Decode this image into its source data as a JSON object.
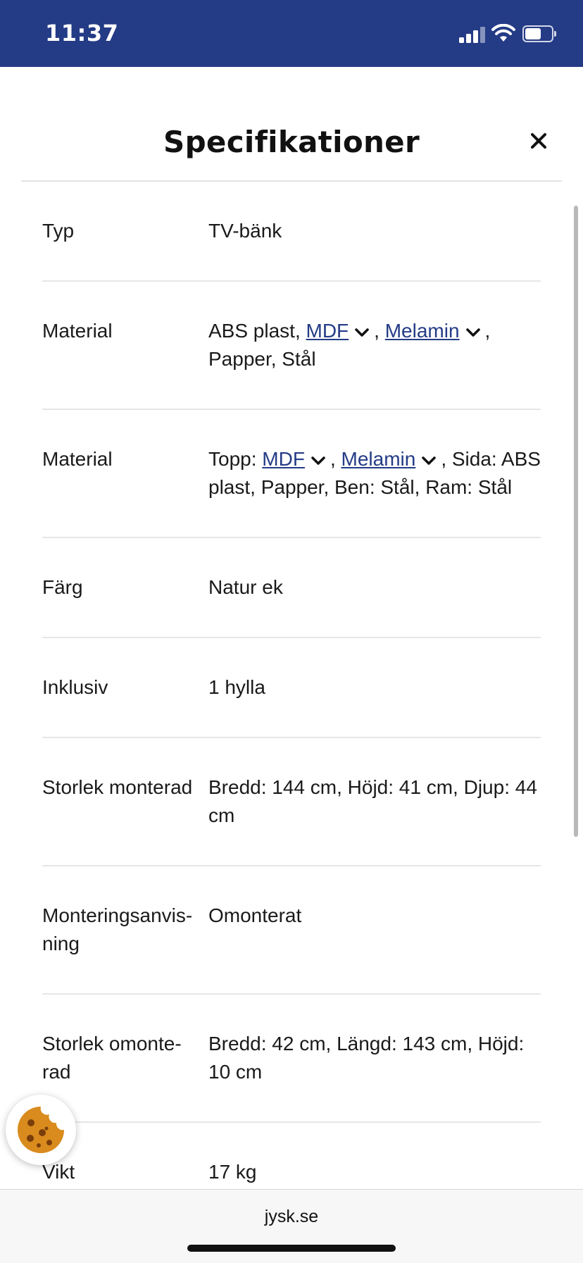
{
  "status_bar": {
    "time": "11:37"
  },
  "modal": {
    "title": "Specifikationer",
    "close_label": "×"
  },
  "specs": [
    {
      "label": "Typ",
      "value": "TV-bänk"
    },
    {
      "label": "Material",
      "parts": {
        "prefix": "ABS plast, ",
        "link1": "MDF",
        "sep": ", ",
        "link2": "Melamin",
        "suffix": ", Papper, Stål"
      }
    },
    {
      "label": "Material",
      "parts": {
        "prefix": "Topp: ",
        "link1": "MDF",
        "sep": ", ",
        "link2": "Melamin",
        "suffix": ", Sida: ABS plast, Papper, Ben: Stål, Ram: Stål"
      }
    },
    {
      "label": "Färg",
      "value": "Natur ek"
    },
    {
      "label": "Inklusiv",
      "value": "1 hylla"
    },
    {
      "label": "Storlek monterad",
      "value": "Bredd: 144 cm, Höjd: 41 cm, Djup: 44 cm"
    },
    {
      "label": "Monteringsanvis-ning",
      "value": "Omonterat"
    },
    {
      "label": "Storlek omonte-rad",
      "value": "Bredd: 42 cm, Längd: 143 cm, Höjd: 10 cm"
    },
    {
      "label": "Vikt",
      "value": "17 kg"
    }
  ],
  "browser": {
    "domain": "jysk.se"
  },
  "colors": {
    "brand": "#243b86",
    "link": "#243b86",
    "cookie": "#d98b1e"
  }
}
